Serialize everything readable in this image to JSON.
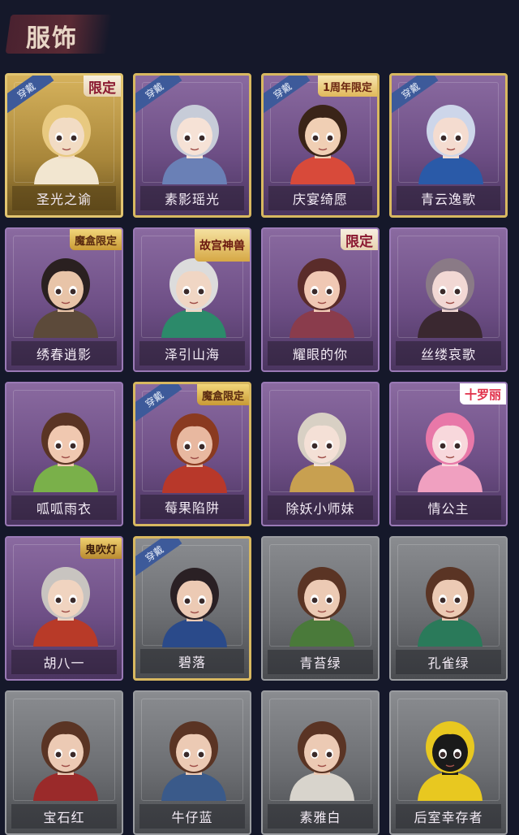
{
  "header": {
    "title": "服饰"
  },
  "cards": [
    {
      "name": "圣光之谕",
      "frame": "gold",
      "worn": true,
      "tag": "限定",
      "tag_type": "limited",
      "skin": "#f2dcc4",
      "hair": "#e8c980",
      "cloth": "#f2e6d0",
      "worn_label": "穿戴"
    },
    {
      "name": "素影瑶光",
      "frame": "purple-gold",
      "worn": true,
      "tag": "",
      "tag_type": "",
      "skin": "#f6e2d6",
      "hair": "#c7ccd8",
      "cloth": "#6a80b6",
      "worn_label": "穿戴"
    },
    {
      "name": "庆宴绮愿",
      "frame": "purple-gold",
      "worn": true,
      "tag": "1周年限定",
      "tag_type": "anniv",
      "skin": "#f0cfb4",
      "hair": "#3a2418",
      "cloth": "#d84a3a",
      "worn_label": "穿戴"
    },
    {
      "name": "青云逸歌",
      "frame": "purple-gold",
      "worn": true,
      "tag": "",
      "tag_type": "",
      "skin": "#f4dcd0",
      "hair": "#cdd6ea",
      "cloth": "#2a5aa8",
      "worn_label": "穿戴"
    },
    {
      "name": "绣春逍影",
      "frame": "purple",
      "worn": false,
      "tag": "魔盒限定",
      "tag_type": "mohe",
      "skin": "#e8c4a8",
      "hair": "#2a2020",
      "cloth": "#5c4a3a",
      "worn_label": ""
    },
    {
      "name": "泽引山海",
      "frame": "purple",
      "worn": false,
      "tag": "故宫神兽",
      "tag_type": "gugong",
      "skin": "#f0d6c4",
      "hair": "#dcdcdc",
      "cloth": "#2c8a6a",
      "worn_label": ""
    },
    {
      "name": "耀眼的你",
      "frame": "purple",
      "worn": false,
      "tag": "限定",
      "tag_type": "limited",
      "skin": "#f0c8b4",
      "hair": "#5a2c2a",
      "cloth": "#8a3c4c",
      "worn_label": ""
    },
    {
      "name": "丝缕哀歌",
      "frame": "purple",
      "worn": false,
      "tag": "",
      "tag_type": "",
      "skin": "#f2d8d4",
      "hair": "#8a7a86",
      "cloth": "#3a2830",
      "worn_label": ""
    },
    {
      "name": "呱呱雨衣",
      "frame": "purple",
      "worn": false,
      "tag": "",
      "tag_type": "",
      "skin": "#f0c8b0",
      "hair": "#5a3424",
      "cloth": "#7ab04a",
      "worn_label": ""
    },
    {
      "name": "莓果陷阱",
      "frame": "purple-gold",
      "worn": true,
      "tag": "魔盒限定",
      "tag_type": "mohe",
      "skin": "#e8b8a0",
      "hair": "#8a3a20",
      "cloth": "#b8382a",
      "worn_label": "穿戴"
    },
    {
      "name": "除妖小师妹",
      "frame": "purple",
      "worn": false,
      "tag": "",
      "tag_type": "",
      "skin": "#f4e0d6",
      "hair": "#d8d0c4",
      "cloth": "#c8a050",
      "worn_label": ""
    },
    {
      "name": "情公主",
      "frame": "purple",
      "worn": false,
      "tag": "十罗丽",
      "tag_type": "shiluo",
      "skin": "#f8d8dc",
      "hair": "#e878a8",
      "cloth": "#f0a0c0",
      "worn_label": ""
    },
    {
      "name": "胡八一",
      "frame": "purple",
      "worn": false,
      "tag": "鬼吹灯",
      "tag_type": "gui",
      "skin": "#f0d4c0",
      "hair": "#c8c4c0",
      "cloth": "#b83a28",
      "worn_label": ""
    },
    {
      "name": "碧落",
      "frame": "gray-gold",
      "worn": true,
      "tag": "",
      "tag_type": "",
      "skin": "#eccab4",
      "hair": "#2a2024",
      "cloth": "#2a4a8a",
      "worn_label": "穿戴"
    },
    {
      "name": "青苔绿",
      "frame": "gray",
      "worn": false,
      "tag": "",
      "tag_type": "",
      "skin": "#eccab4",
      "hair": "#5a3424",
      "cloth": "#4a7a3a",
      "worn_label": ""
    },
    {
      "name": "孔雀绿",
      "frame": "gray",
      "worn": false,
      "tag": "",
      "tag_type": "",
      "skin": "#eccab4",
      "hair": "#5a3424",
      "cloth": "#2a7a5a",
      "worn_label": ""
    },
    {
      "name": "宝石红",
      "frame": "gray",
      "worn": false,
      "tag": "",
      "tag_type": "",
      "skin": "#eccab4",
      "hair": "#5a3424",
      "cloth": "#9a2a2a",
      "worn_label": ""
    },
    {
      "name": "牛仔蓝",
      "frame": "gray",
      "worn": false,
      "tag": "",
      "tag_type": "",
      "skin": "#eccab4",
      "hair": "#5a3424",
      "cloth": "#3a5a8a",
      "worn_label": ""
    },
    {
      "name": "素雅白",
      "frame": "gray",
      "worn": false,
      "tag": "",
      "tag_type": "",
      "skin": "#eccab4",
      "hair": "#5a3424",
      "cloth": "#d8d4cc",
      "worn_label": ""
    },
    {
      "name": "后室幸存者",
      "frame": "gray",
      "worn": false,
      "tag": "",
      "tag_type": "",
      "skin": "#1a1a1a",
      "hair": "#e8c820",
      "cloth": "#e8c820",
      "worn_label": ""
    }
  ]
}
